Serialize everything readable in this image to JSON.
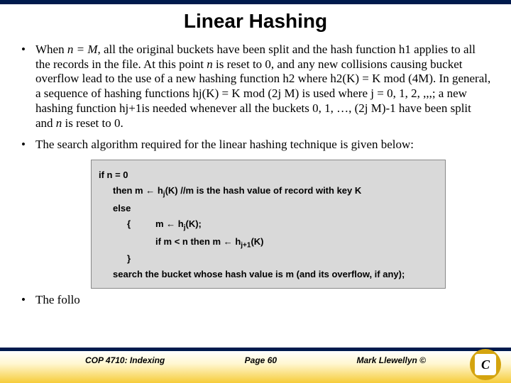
{
  "title": "Linear Hashing",
  "bullets": {
    "b1_pre": "When ",
    "b1_var": "n = M",
    "b1_mid": ", all the original buckets have been split and the hash function h1 applies to all the records in the file.  At this point ",
    "b1_n": "n",
    "b1_after_n": " is reset to 0, and any new collisions causing bucket overflow lead to the use of a new hashing function h2 where h2(K) = K mod (4M).  In general, a sequence of hashing functions hj(K) = K mod (2j M) is used where j = 0, 1, 2, ,,,; a new hashing function hj+1is needed whenever all the buckets 0, 1, …, (2j M)-1 have been split and ",
    "b1_n2": "n",
    "b1_end": " is reset to 0.",
    "b2": "The search algorithm required for the linear hashing technique is given below:",
    "b3": "The follo"
  },
  "algo": {
    "l1": "if n = 0",
    "l2_pre": "then m ",
    "l2_arrow": "←",
    "l2_post": " h",
    "l2_sub": "j",
    "l2_rest": "(K)  //m is the hash value of record with key K",
    "l3": "else",
    "l4_brace": "{",
    "l4_pre": "m ",
    "l4_arrow": "←",
    "l4_post": " h",
    "l4_sub": "j",
    "l4_rest": "(K);",
    "l5_pre": "if m < n then m ",
    "l5_arrow": "←",
    "l5_post": " h",
    "l5_sub": "j+1",
    "l5_rest": "(K)",
    "l6": "}",
    "l7": "search the bucket whose hash value is m (and its overflow, if any);"
  },
  "footer": {
    "course": "COP 4710: Indexing",
    "page": "Page 60",
    "author": "Mark Llewellyn ©"
  },
  "logo_letter": "C"
}
